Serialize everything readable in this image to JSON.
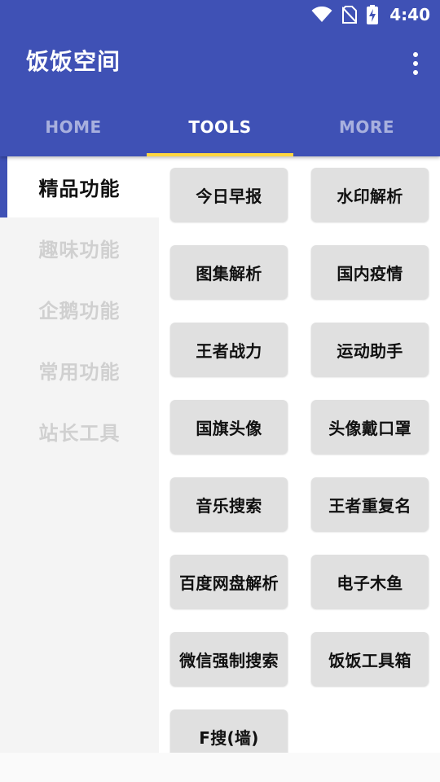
{
  "status": {
    "time": "4:40"
  },
  "app": {
    "title": "饭饭空间"
  },
  "tabs": [
    {
      "label": "HOME",
      "active": false
    },
    {
      "label": "TOOLS",
      "active": true
    },
    {
      "label": "MORE",
      "active": false
    }
  ],
  "sidebar": {
    "items": [
      {
        "label": "精品功能",
        "active": true
      },
      {
        "label": "趣味功能",
        "active": false
      },
      {
        "label": "企鹅功能",
        "active": false
      },
      {
        "label": "常用功能",
        "active": false
      },
      {
        "label": "站长工具",
        "active": false
      }
    ]
  },
  "tools": [
    "今日早报",
    "水印解析",
    "图集解析",
    "国内疫情",
    "王者战力",
    "运动助手",
    "国旗头像",
    "头像戴口罩",
    "音乐搜索",
    "王者重复名",
    "百度网盘解析",
    "电子木鱼",
    "微信强制搜索",
    "饭饭工具箱",
    "F搜(墙)"
  ],
  "colors": {
    "primary": "#3f51b5",
    "indicator": "#ffd740",
    "tile": "#e0e0e0"
  }
}
